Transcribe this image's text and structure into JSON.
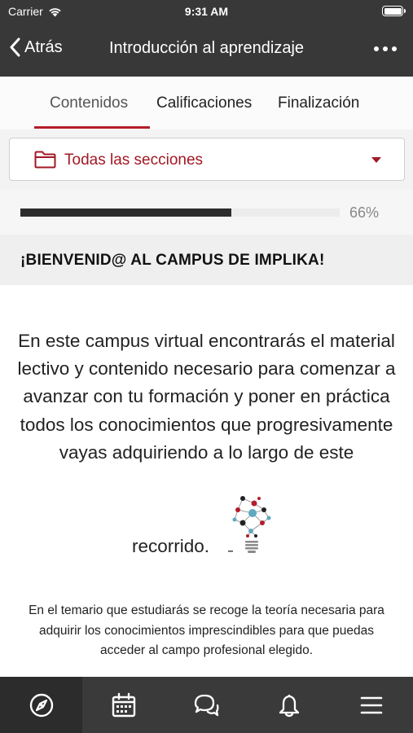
{
  "status_bar": {
    "carrier": "Carrier",
    "time": "9:31 AM",
    "wifi_icon": "wifi-icon",
    "battery_icon": "battery-icon"
  },
  "nav": {
    "back_label": "Atrás",
    "title": "Introducción al aprendizaje",
    "more_icon": "ellipsis-icon"
  },
  "tabs": [
    {
      "label": "Contenidos",
      "active": true
    },
    {
      "label": "Calificaciones",
      "active": false
    },
    {
      "label": "Finalización",
      "active": false
    }
  ],
  "section_selector": {
    "icon": "folder-icon",
    "label": "Todas las secciones",
    "caret_icon": "caret-down-icon"
  },
  "progress": {
    "value": 0.66,
    "label": "66%"
  },
  "section": {
    "title": "¡BIENVENID@ AL CAMPUS DE IMPLIKA!"
  },
  "content": {
    "intro_paragraph": "En este campus virtual encontrarás el material lectivo y contenido necesario para comenzar a avanzar con tu formación y poner en práctica todos los conocimientos que progresivamente vayas adquiriendo a lo largo de este",
    "intro_end": "recorrido.",
    "image_icon": "lightbulb-network-icon",
    "secondary_paragraph": "En el temario que estudiarás se recoge la teoría necesaria para adquirir los conocimientos imprescindibles para que puedas acceder al campo profesional elegido."
  },
  "bottom_nav": [
    {
      "icon": "compass-icon",
      "active": true
    },
    {
      "icon": "calendar-icon",
      "active": false
    },
    {
      "icon": "chat-icon",
      "active": false
    },
    {
      "icon": "bell-icon",
      "active": false
    },
    {
      "icon": "menu-icon",
      "active": false
    }
  ],
  "colors": {
    "accent": "#a11825",
    "topbar": "#383838",
    "bottombar": "#3a3a3a"
  }
}
